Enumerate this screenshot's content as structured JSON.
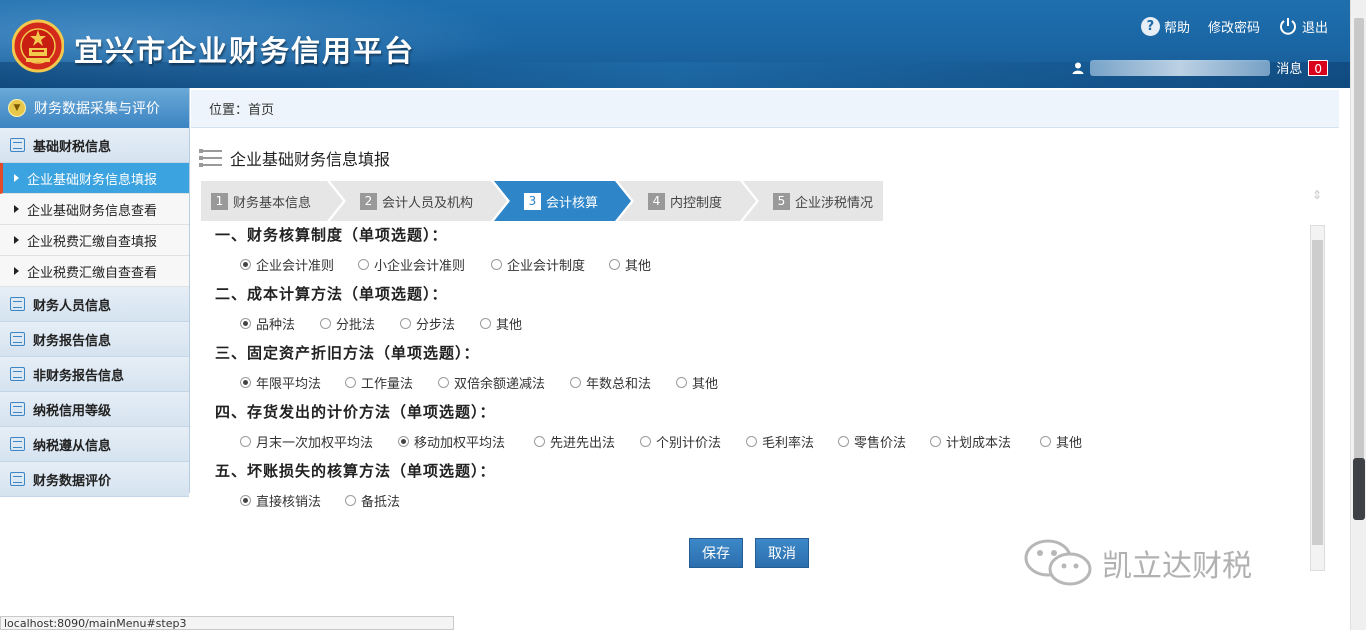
{
  "header": {
    "site_title": "宜兴市企业财务信用平台",
    "help_label": "帮助",
    "change_password_label": "修改密码",
    "logout_label": "退出",
    "message_label": "消息",
    "message_count": "0"
  },
  "sidebar": {
    "module_title": "财务数据采集与评价",
    "categories": [
      {
        "label": "基础财税信息"
      },
      {
        "label": "财务人员信息"
      },
      {
        "label": "财务报告信息"
      },
      {
        "label": "非财务报告信息"
      },
      {
        "label": "纳税信用等级"
      },
      {
        "label": "纳税遵从信息"
      },
      {
        "label": "财务数据评价"
      }
    ],
    "sub_items": [
      {
        "label": "企业基础财务信息填报",
        "active": true
      },
      {
        "label": "企业基础财务信息查看",
        "active": false
      },
      {
        "label": "企业税费汇缴自查填报",
        "active": false
      },
      {
        "label": "企业税费汇缴自查查看",
        "active": false
      }
    ]
  },
  "breadcrumb": {
    "label": "位置：首页"
  },
  "page_title": "企业基础财务信息填报",
  "steps": [
    {
      "num": "1",
      "label": "财务基本信息",
      "active": false
    },
    {
      "num": "2",
      "label": "会计人员及机构",
      "active": false
    },
    {
      "num": "3",
      "label": "会计核算",
      "active": true
    },
    {
      "num": "4",
      "label": "内控制度",
      "active": false
    },
    {
      "num": "5",
      "label": "企业涉税情况",
      "active": false
    }
  ],
  "questions": [
    {
      "title": "一、财务核算制度（单项选题）：",
      "options": [
        {
          "label": "企业会计准则",
          "selected": true
        },
        {
          "label": "小企业会计准则",
          "selected": false
        },
        {
          "label": "企业会计制度",
          "selected": false
        },
        {
          "label": "其他",
          "selected": false
        }
      ]
    },
    {
      "title": "二、成本计算方法（单项选题）：",
      "options": [
        {
          "label": "品种法",
          "selected": true
        },
        {
          "label": "分批法",
          "selected": false
        },
        {
          "label": "分步法",
          "selected": false
        },
        {
          "label": "其他",
          "selected": false
        }
      ]
    },
    {
      "title": "三、固定资产折旧方法（单项选题）：",
      "options": [
        {
          "label": "年限平均法",
          "selected": true
        },
        {
          "label": "工作量法",
          "selected": false
        },
        {
          "label": "双倍余额递减法",
          "selected": false
        },
        {
          "label": "年数总和法",
          "selected": false
        },
        {
          "label": "其他",
          "selected": false
        }
      ]
    },
    {
      "title": "四、存货发出的计价方法（单项选题）：",
      "options": [
        {
          "label": "月末一次加权平均法",
          "selected": false
        },
        {
          "label": "移动加权平均法",
          "selected": true
        },
        {
          "label": "先进先出法",
          "selected": false
        },
        {
          "label": "个别计价法",
          "selected": false
        },
        {
          "label": "毛利率法",
          "selected": false
        },
        {
          "label": "零售价法",
          "selected": false
        },
        {
          "label": "计划成本法",
          "selected": false
        },
        {
          "label": "其他",
          "selected": false
        }
      ]
    },
    {
      "title": "五、坏账损失的核算方法（单项选题）：",
      "options": [
        {
          "label": "直接核销法",
          "selected": true
        },
        {
          "label": "备抵法",
          "selected": false
        }
      ]
    }
  ],
  "buttons": {
    "save_label": "保存",
    "cancel_label": "取消"
  },
  "watermark": {
    "text": "凯立达财税"
  },
  "status_bar": {
    "url": "localhost:8090/mainMenu#step3"
  },
  "colors": {
    "header_blue": "#1f6fae",
    "active_step": "#2e86c9",
    "active_menu": "#3ba3df",
    "badge_red": "#d9001b"
  }
}
